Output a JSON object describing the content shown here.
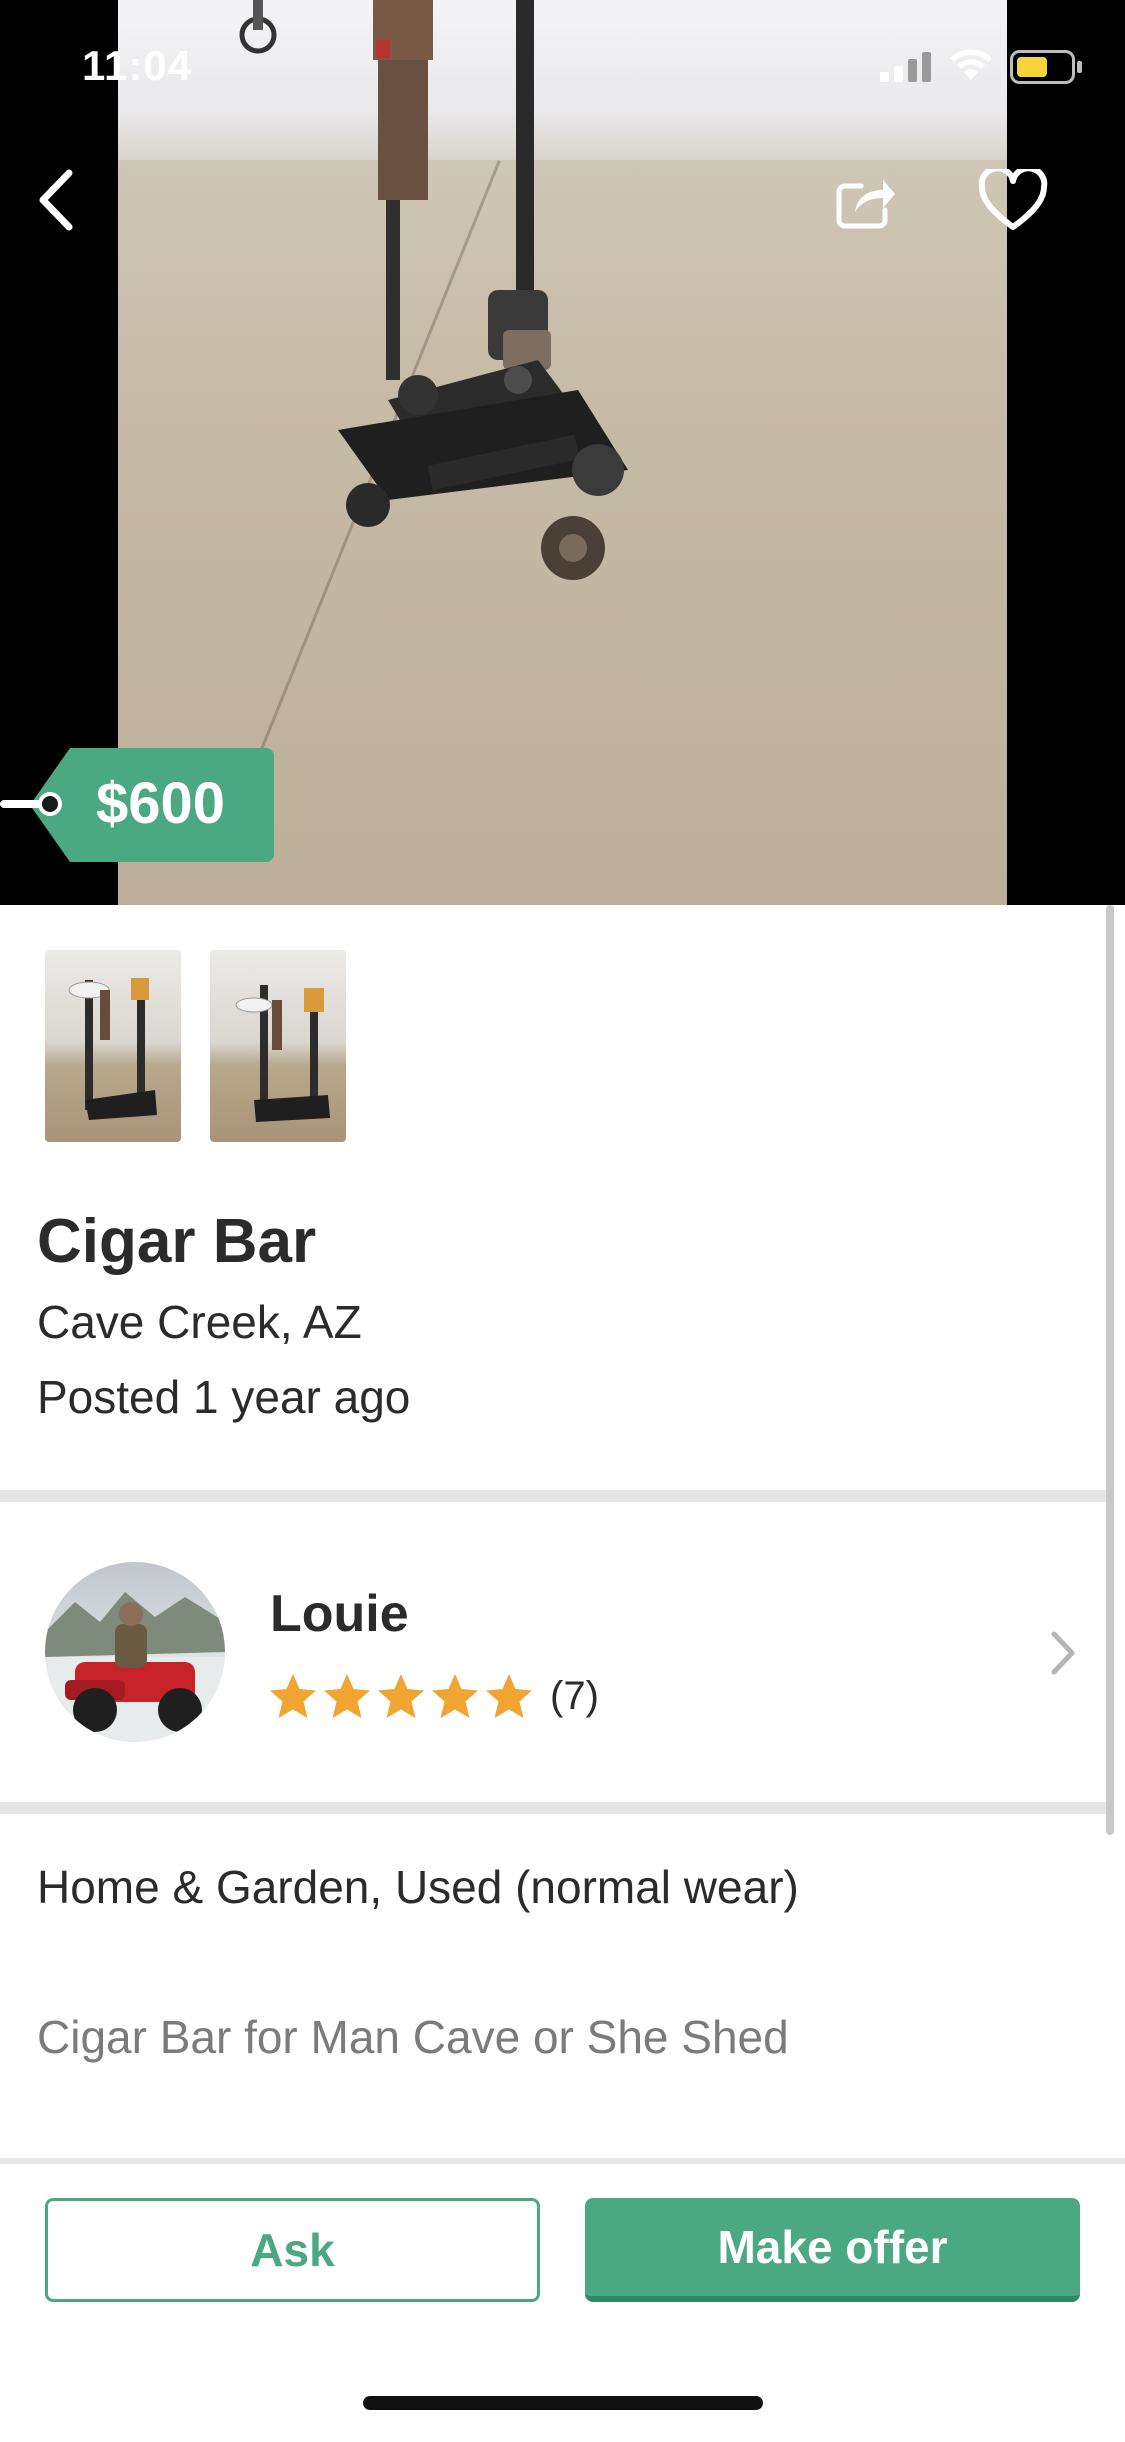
{
  "status_bar": {
    "time": "11:04",
    "icons": [
      "signal-icon",
      "wifi-icon",
      "battery-icon"
    ]
  },
  "nav": {
    "icons": [
      "back-arrow-icon",
      "share-icon",
      "heart-icon"
    ]
  },
  "listing": {
    "price": "$600",
    "title": "Cigar Bar",
    "location": "Cave Creek, AZ",
    "posted": "Posted 1 year ago",
    "category_condition": "Home & Garden, Used (normal wear)",
    "description": "Cigar Bar for Man Cave or She Shed",
    "thumbnail_count": 2
  },
  "seller": {
    "name": "Louie",
    "rating": 5,
    "rating_count": "(7)"
  },
  "actions": {
    "ask_label": "Ask",
    "offer_label": "Make offer"
  },
  "colors": {
    "brand_green": "#4aa882",
    "star": "#f0a532",
    "divider": "#e6e6e6"
  }
}
